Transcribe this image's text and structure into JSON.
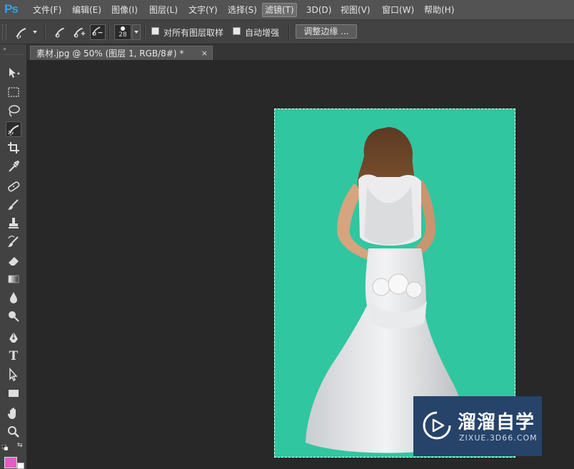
{
  "app": {
    "logo": "Ps"
  },
  "menu": [
    "文件(F)",
    "编辑(E)",
    "图像(I)",
    "图层(L)",
    "文字(Y)",
    "选择(S)",
    "滤镜(T)",
    "3D(D)",
    "视图(V)",
    "窗口(W)",
    "帮助(H)"
  ],
  "menu_active_index": 6,
  "options": {
    "brush_size": "28",
    "sample_all_layers_label": "对所有图层取样",
    "sample_all_layers_checked": false,
    "auto_enhance_label": "自动增强",
    "auto_enhance_checked": false,
    "refine_edge_label": "调整边缘 ..."
  },
  "document_tab": {
    "title": "素材.jpg @ 50% (图层 1, RGB/8#) *",
    "close": "×"
  },
  "watermark": {
    "title": "溜溜自学",
    "url": "ZIXUE.3D66.COM"
  },
  "colors": {
    "foreground": "#e75bc5",
    "background": "#ffffff",
    "canvas": "#30c6a0",
    "accent": "#2fa3e8"
  },
  "tools": [
    "move-tool",
    "marquee-tool",
    "lasso-tool",
    "quick-selection-tool",
    "crop-tool",
    "eyedropper-tool",
    "healing-brush-tool",
    "brush-tool",
    "clone-stamp-tool",
    "history-brush-tool",
    "eraser-tool",
    "gradient-tool",
    "blur-tool",
    "dodge-tool",
    "pen-tool",
    "type-tool",
    "path-selection-tool",
    "rectangle-tool",
    "hand-tool",
    "zoom-tool"
  ],
  "type_tool_glyph": "T"
}
